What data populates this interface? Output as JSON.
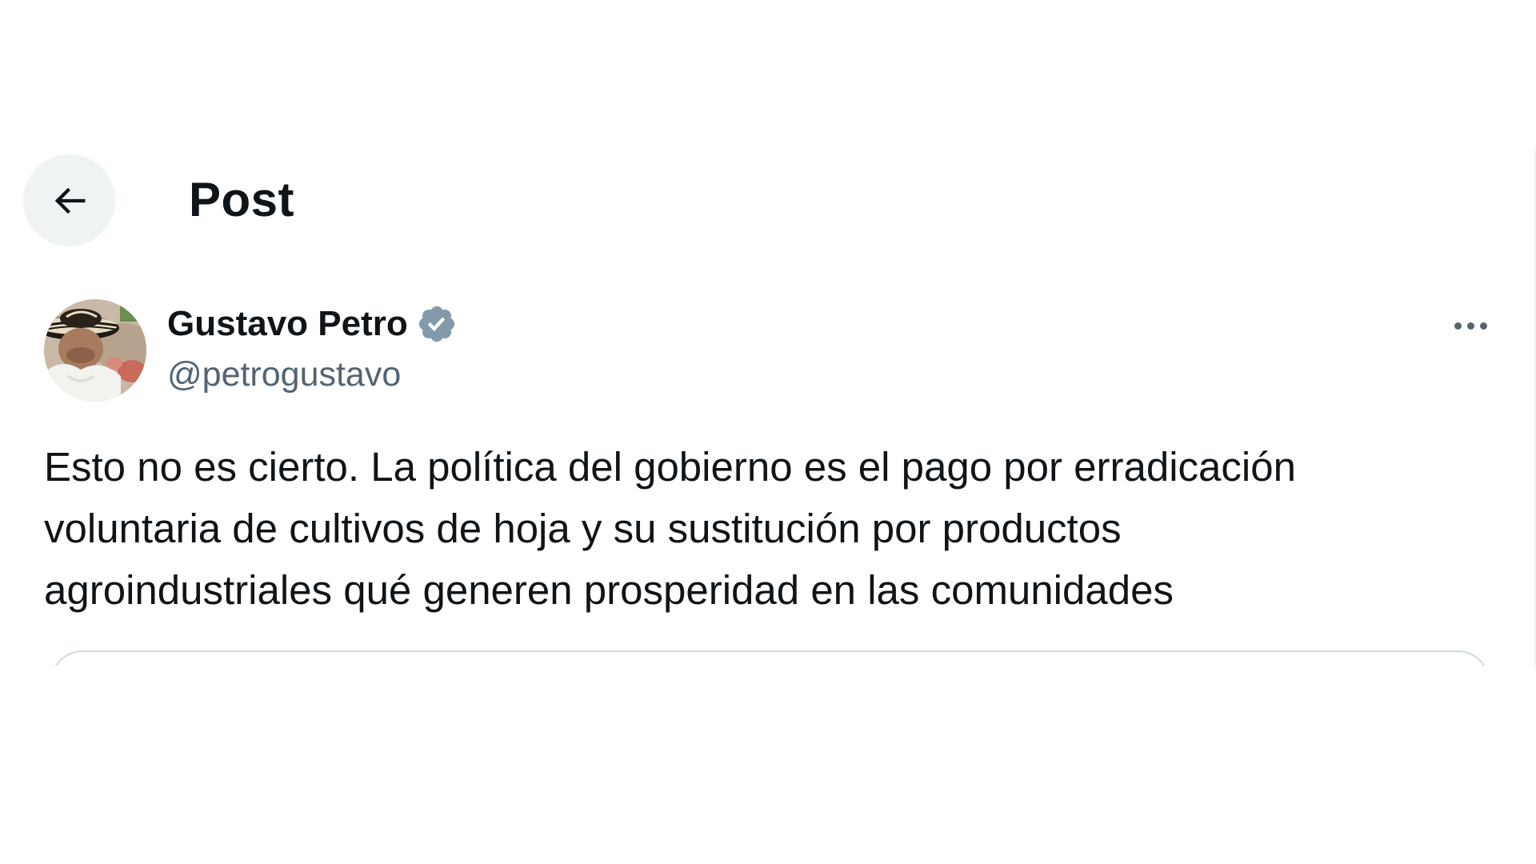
{
  "header": {
    "title": "Post"
  },
  "tweet": {
    "author_name": "Gustavo Petro",
    "author_handle": "@petrogustavo",
    "verified": true,
    "text_lines": [
      "Esto no es cierto. La política del gobierno es el pago por erradicación",
      "voluntaria de cultivos de hoja y su sustitución por productos",
      "agroindustriales qué generen prosperidad en las comunidades"
    ]
  },
  "icons": {
    "back": "arrow-left-icon",
    "verified": "verified-badge-icon",
    "more": "more-horizontal-icon"
  },
  "colors": {
    "text_primary": "#0f1419",
    "text_secondary": "#536471",
    "verified_badge": "#829aab",
    "button_bg": "#eff3f4",
    "border": "#cfd9de"
  }
}
